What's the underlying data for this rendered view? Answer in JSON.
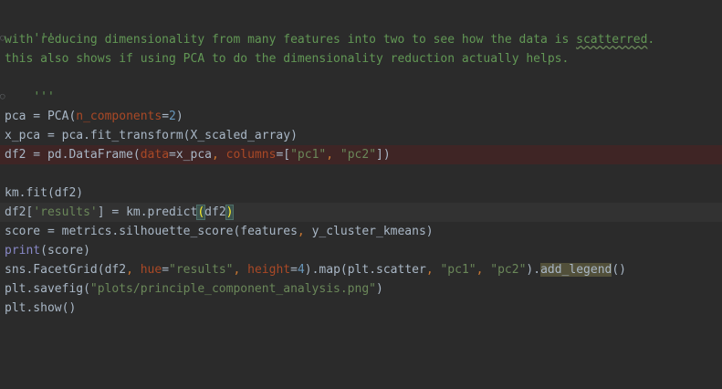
{
  "code": {
    "l1_open": "'''",
    "l2_doc": "with reducing dimensionality from many features into two to see how the data is ",
    "l2_typo": "scatterred",
    "l2_end": ".",
    "l3_doc": "this also shows if using PCA to do the dimensionality reduction actually helps.",
    "l4_close": "'''",
    "l6": {
      "a": "pca = PCA(",
      "param": "n_components",
      "eq": "=",
      "num": "2",
      "b": ")"
    },
    "l7": "x_pca = pca.fit_transform(X_scaled_array)",
    "l8": {
      "a": "df2 = pd.DataFrame(",
      "p1": "data",
      "eq1": "=x_pca",
      "comma": ", ",
      "p2": "columns",
      "eq2": "=[",
      "s1": "\"pc1\"",
      "c2": ", ",
      "s2": "\"pc2\"",
      "b": "])"
    },
    "l10": "km.fit(df2)",
    "l11": {
      "a": "df2[",
      "s": "'results'",
      "b": "] = km.predict",
      "lp": "(",
      "arg": "df2",
      "rp": ")"
    },
    "l12": {
      "a": "score = metrics.silhouette_score(features",
      "comma": ", ",
      "b": "y_cluster_kmeans)"
    },
    "l13": {
      "fn": "print",
      "b": "(score)"
    },
    "l14": {
      "a": "sns.FacetGrid(df2",
      "c1": ", ",
      "p1": "hue",
      "eq1": "=",
      "s1": "\"results\"",
      "c2": ", ",
      "p2": "height",
      "eq2": "=",
      "n": "4",
      "b": ").map(plt.scatter",
      "c3": ", ",
      "s2": "\"pc1\"",
      "c4": ", ",
      "s3": "\"pc2\"",
      "d": ").",
      "method": "add_legend",
      "e": "()"
    },
    "l15": {
      "a": "plt.savefig(",
      "s": "\"plots/principle_component_analysis.png\"",
      "b": ")"
    },
    "l16": "plt.show()"
  }
}
